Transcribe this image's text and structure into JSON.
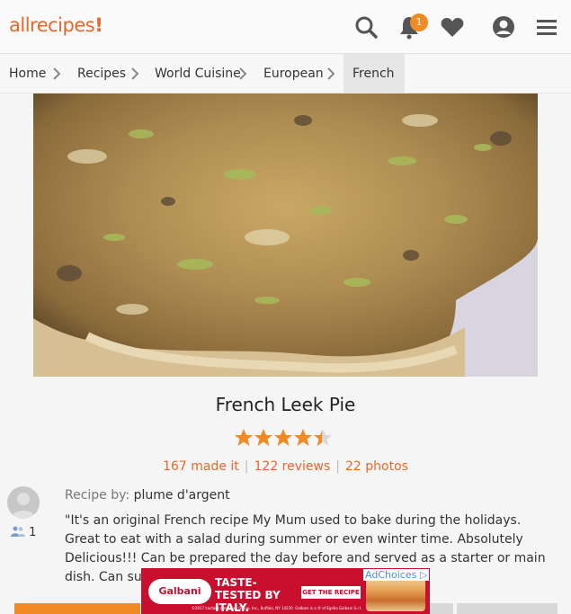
{
  "header": {
    "logo_text": "allrecipes",
    "logo_accent": "!",
    "notification_count": "1",
    "icons": [
      "search-icon",
      "bell-icon",
      "heart-icon",
      "profile-icon",
      "menu-icon"
    ],
    "accent_color": "#e8682a"
  },
  "breadcrumb": {
    "items": [
      "Home",
      "Recipes",
      "World Cuisine",
      "European",
      "French"
    ]
  },
  "recipe": {
    "title": "French Leek Pie",
    "rating": 4.5,
    "made_it": "167 made it",
    "reviews": "122 reviews",
    "photos": "22 photos",
    "byline_label": "Recipe by:",
    "author": "plume d'argent",
    "followers": "1",
    "description": "\"It's an original French recipe My Mum used to bake during the holidays. Great to eat with a salad during summer or even winter time. Absolutely Delicious!!! Can be prepared the day before and served as a starter or main dish. Can substitute Emmental fo"
  },
  "ad": {
    "brand": "Galbani",
    "headline": "TASTE-TESTED BY ITALY.",
    "cta": "GET THE RECIPE ▸",
    "legal": "©2017 Lactalis American Group, Inc., Buffalo, NY 14220. Galbani is a ® of Egidio Galbani S.r.l.",
    "adchoices": "AdChoices"
  }
}
